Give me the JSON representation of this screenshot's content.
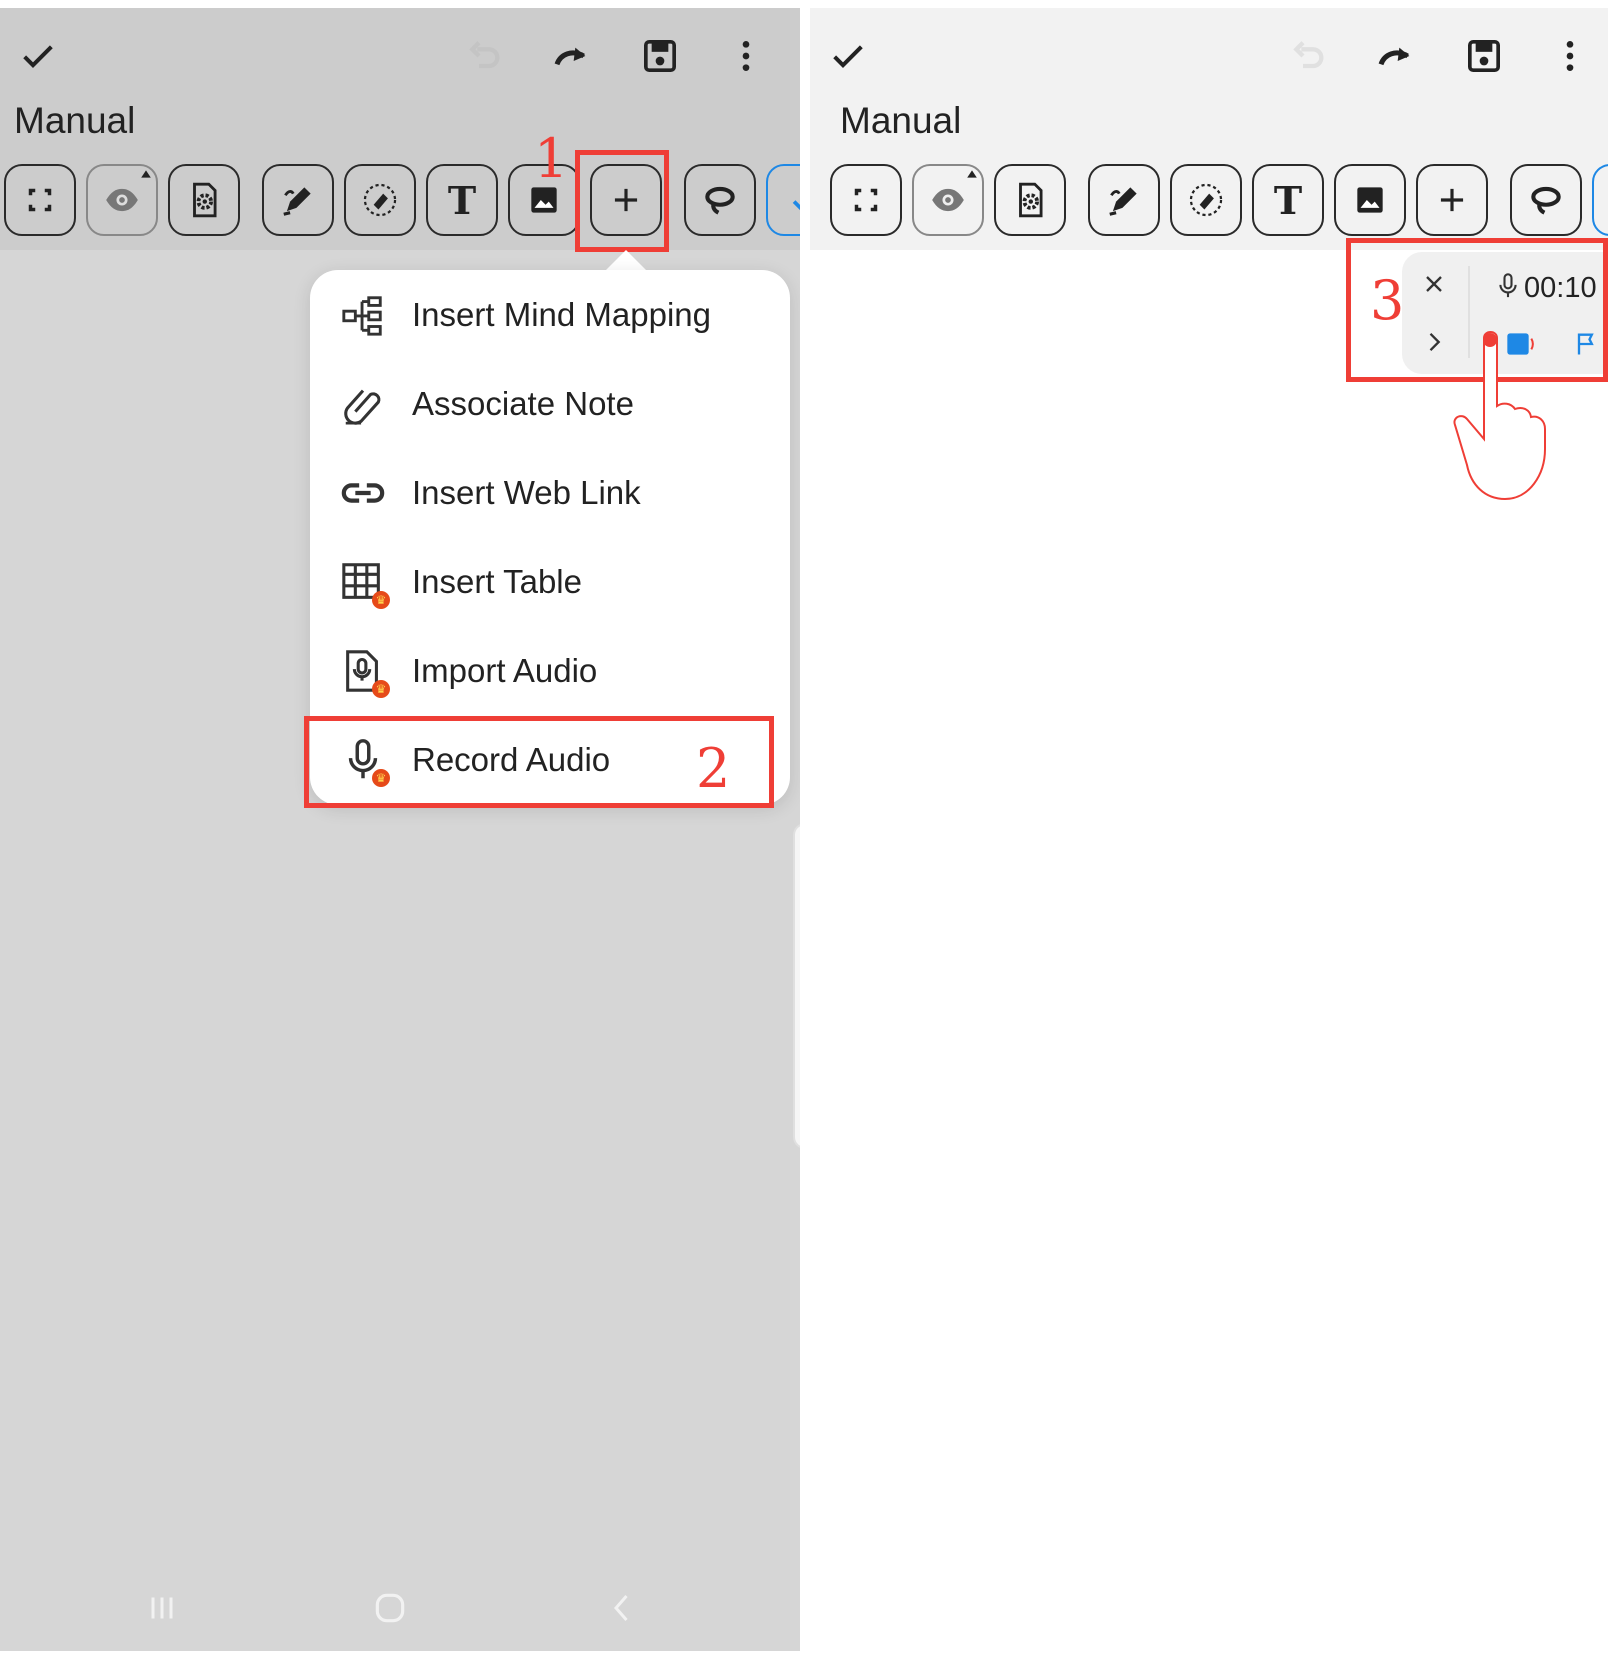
{
  "document": {
    "title": "Manual"
  },
  "topbar": {
    "icons": [
      "check-icon",
      "undo-icon",
      "redo-icon",
      "save-icon",
      "more-vertical-icon"
    ]
  },
  "toolbar": {
    "tools": [
      "fit-screen-icon",
      "eye-icon",
      "page-settings-icon",
      "pen-icon",
      "eraser-icon",
      "text-icon",
      "image-icon",
      "add-icon",
      "lasso-icon"
    ],
    "text_tool_glyph": "T"
  },
  "insert_menu": {
    "items": [
      {
        "label": "Insert Mind Mapping",
        "icon": "mind-map-icon"
      },
      {
        "label": "Associate Note",
        "icon": "paperclip-icon"
      },
      {
        "label": "Insert Web Link",
        "icon": "link-icon"
      },
      {
        "label": "Insert Table",
        "icon": "table-icon"
      },
      {
        "label": "Import Audio",
        "icon": "audio-file-icon"
      },
      {
        "label": "Record Audio",
        "icon": "microphone-icon"
      }
    ]
  },
  "recorder": {
    "time": "00:10"
  },
  "steps": {
    "one": "1",
    "two": "2",
    "three": "3"
  },
  "colors": {
    "annotation": "#ef3e36",
    "accent_blue": "#1e88e5"
  }
}
